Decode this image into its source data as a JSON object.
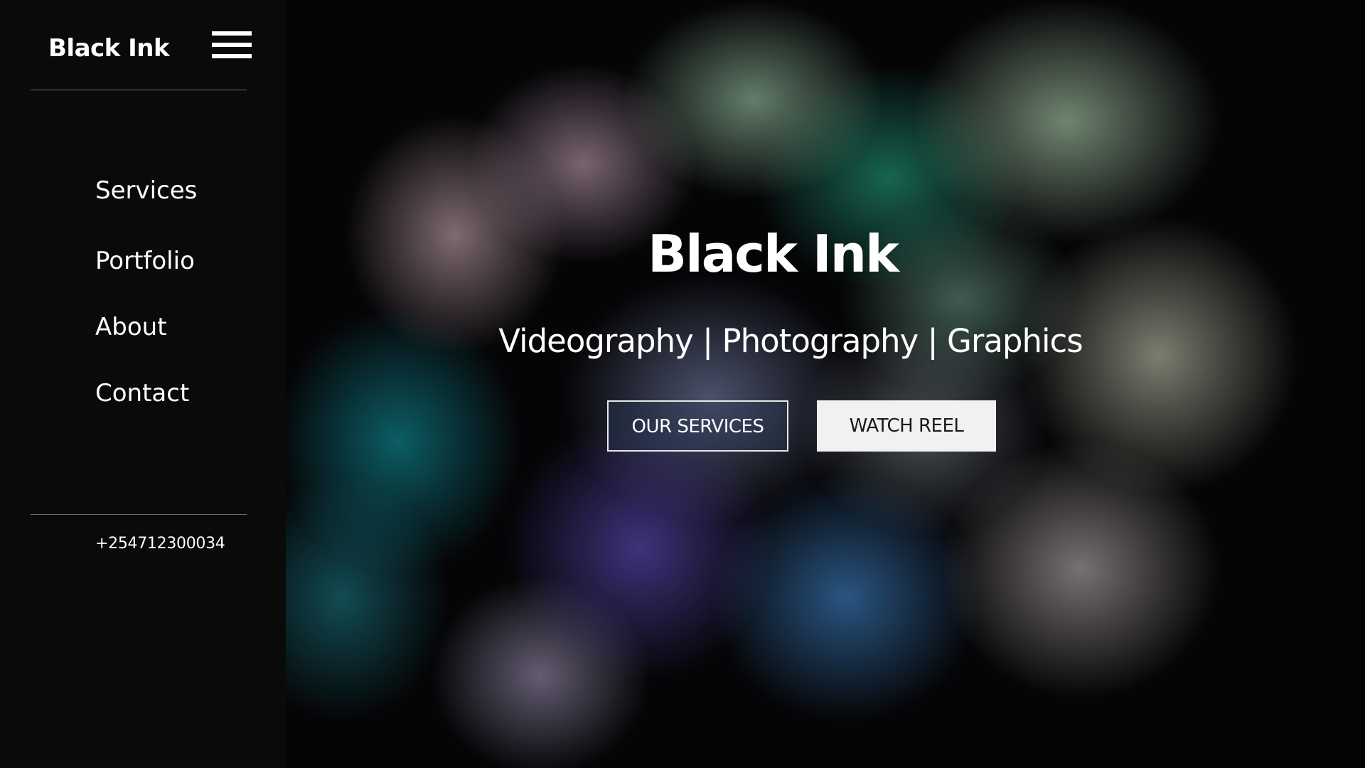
{
  "sidebar": {
    "brand": "Black Ink",
    "menu_icon": "hamburger-menu-icon",
    "nav_items": [
      {
        "label": "Services"
      },
      {
        "label": "Portfolio"
      },
      {
        "label": "About"
      },
      {
        "label": "Contact"
      }
    ],
    "phone": "+254712300034"
  },
  "hero": {
    "title": "Black Ink",
    "subtitle": "Videography | Photography | Graphics",
    "buttons": {
      "services_label": "OUR SERVICES",
      "reel_label": "WATCH REEL"
    }
  },
  "colors": {
    "sidebar_bg": "#0a0a0a",
    "text": "#ffffff",
    "solid_button_bg": "#f1f1f1"
  }
}
